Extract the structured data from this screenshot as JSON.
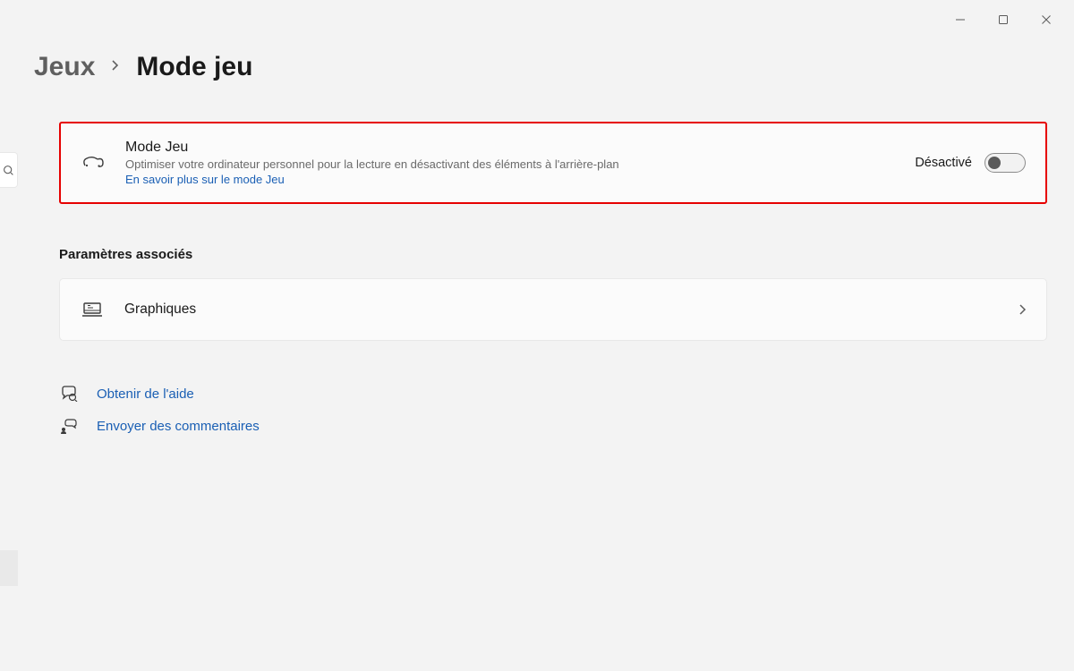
{
  "breadcrumb": {
    "parent": "Jeux",
    "current": "Mode jeu"
  },
  "gameMode": {
    "title": "Mode Jeu",
    "description": "Optimiser votre ordinateur personnel pour la lecture en désactivant des éléments à l'arrière-plan",
    "learnMore": "En savoir plus sur le mode Jeu",
    "toggleState": "Désactivé"
  },
  "relatedHeading": "Paramètres associés",
  "graphics": {
    "label": "Graphiques"
  },
  "footer": {
    "help": "Obtenir de l'aide",
    "feedback": "Envoyer des commentaires"
  }
}
